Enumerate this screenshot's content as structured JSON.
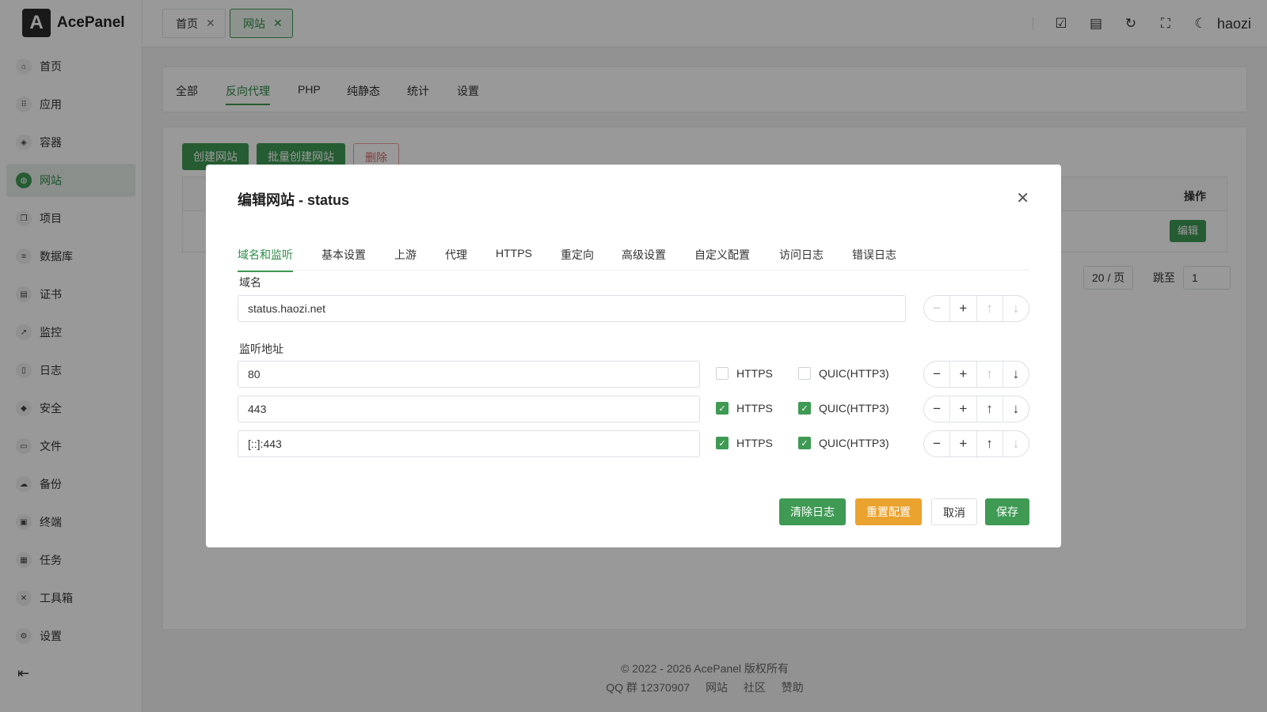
{
  "app": {
    "logo_letter": "A",
    "name": "AcePanel"
  },
  "sidebar": {
    "items": [
      {
        "label": "首页",
        "icon": "home-icon",
        "glyph": "⌂"
      },
      {
        "label": "应用",
        "icon": "apps-icon",
        "glyph": "⠿"
      },
      {
        "label": "容器",
        "icon": "layers-icon",
        "glyph": "◈"
      },
      {
        "label": "网站",
        "icon": "globe-icon",
        "glyph": "◍"
      },
      {
        "label": "项目",
        "icon": "folder-stack-icon",
        "glyph": "❐"
      },
      {
        "label": "数据库",
        "icon": "database-icon",
        "glyph": "≡"
      },
      {
        "label": "证书",
        "icon": "certificate-icon",
        "glyph": "▤"
      },
      {
        "label": "监控",
        "icon": "chart-line-icon",
        "glyph": "↗"
      },
      {
        "label": "日志",
        "icon": "document-icon",
        "glyph": "▯"
      },
      {
        "label": "安全",
        "icon": "shield-icon",
        "glyph": "◆"
      },
      {
        "label": "文件",
        "icon": "folder-icon",
        "glyph": "▭"
      },
      {
        "label": "备份",
        "icon": "cloud-icon",
        "glyph": "☁"
      },
      {
        "label": "终端",
        "icon": "terminal-icon",
        "glyph": "▣"
      },
      {
        "label": "任务",
        "icon": "task-icon",
        "glyph": "▦"
      },
      {
        "label": "工具箱",
        "icon": "tools-icon",
        "glyph": "✕"
      },
      {
        "label": "设置",
        "icon": "gear-icon",
        "glyph": "⚙"
      }
    ],
    "active_index": 3
  },
  "topbar": {
    "tabs": [
      {
        "label": "首页"
      },
      {
        "label": "网站"
      }
    ],
    "user": "haozi"
  },
  "page": {
    "tabs": [
      "全部",
      "反向代理",
      "PHP",
      "纯静态",
      "统计",
      "设置"
    ],
    "active_tab": 1,
    "buttons": {
      "create": "创建网站",
      "batch_create": "批量创建网站",
      "delete": "删除"
    },
    "table": {
      "op_header": "操作",
      "edit": "编辑"
    },
    "pager": {
      "page_size": "20 / 页",
      "jump_label": "跳至",
      "jump_value": "1"
    }
  },
  "footer": {
    "copyright": "© 2022 - 2026 AcePanel 版权所有",
    "links": [
      "QQ 群 12370907",
      "网站",
      "社区",
      "赞助"
    ]
  },
  "modal": {
    "title": "编辑网站 - status",
    "tabs": [
      "域名和监听",
      "基本设置",
      "上游",
      "代理",
      "HTTPS",
      "重定向",
      "高级设置",
      "自定义配置",
      "访问日志",
      "错误日志"
    ],
    "active_tab": 0,
    "domain_label": "域名",
    "domain_value": "status.haozi.net",
    "listen_label": "监听地址",
    "listens": [
      {
        "address": "80",
        "https": false,
        "quic": false
      },
      {
        "address": "443",
        "https": true,
        "quic": true
      },
      {
        "address": "[::]:443",
        "https": true,
        "quic": true
      }
    ],
    "https_label": "HTTPS",
    "quic_label": "QUIC(HTTP3)",
    "buttons": {
      "clear_log": "清除日志",
      "reset_config": "重置配置",
      "cancel": "取消",
      "save": "保存"
    }
  },
  "colors": {
    "accent": "#3f9a54",
    "warning": "#eba32f",
    "danger": "#d46b6b"
  }
}
